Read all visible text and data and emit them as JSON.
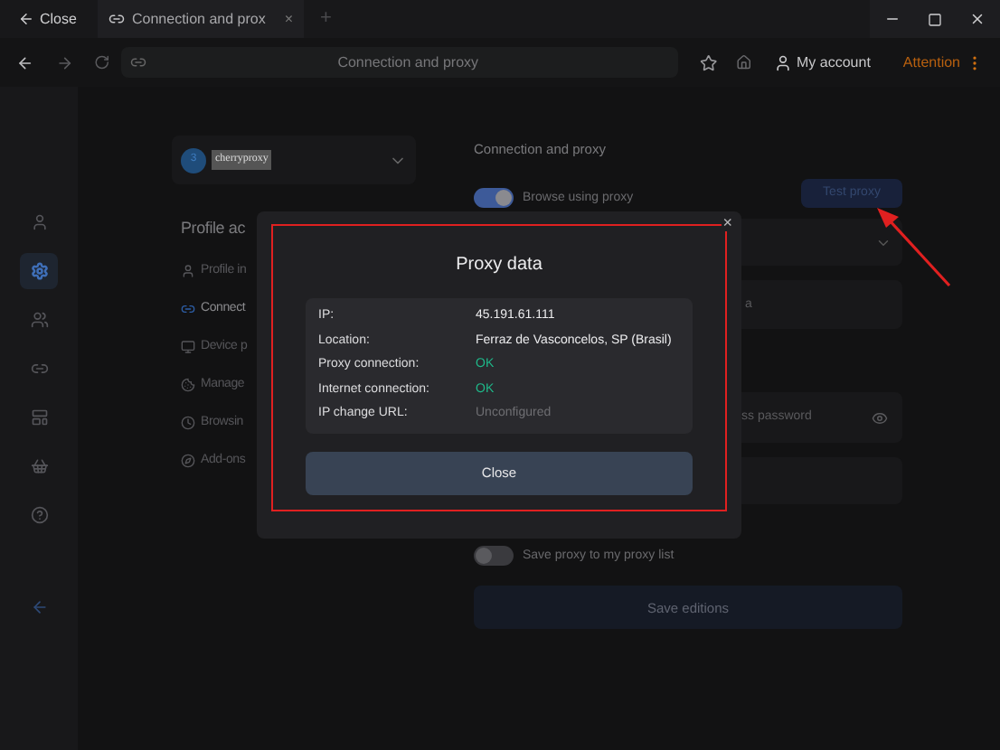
{
  "title_bar": {
    "close_label": "Close",
    "tab_title": "Connection and prox",
    "tab_close": "×",
    "new_tab": "+"
  },
  "nav_bar": {
    "address": "Connection and proxy",
    "account": "My account",
    "attention": "Attention"
  },
  "sidebar": {
    "items": [
      {
        "kind": "user",
        "selected": false
      },
      {
        "kind": "gear",
        "selected": true
      },
      {
        "kind": "users",
        "selected": false
      },
      {
        "kind": "link",
        "selected": false
      },
      {
        "kind": "layout",
        "selected": false
      },
      {
        "kind": "basket",
        "selected": false
      },
      {
        "kind": "help",
        "selected": false
      }
    ]
  },
  "profile": {
    "avatar_letter": "3",
    "name": "cherryproxy",
    "heading": "Profile ac",
    "menu": [
      {
        "label": "Profile in",
        "kind": "user",
        "selected": false
      },
      {
        "label": "Connect",
        "kind": "link",
        "selected": true
      },
      {
        "label": "Device p",
        "kind": "device",
        "selected": false
      },
      {
        "label": "Manage",
        "kind": "cookie",
        "selected": false
      },
      {
        "label": "Browsin",
        "kind": "clock",
        "selected": false
      },
      {
        "label": "Add-ons",
        "kind": "compass",
        "selected": false
      }
    ]
  },
  "connection": {
    "heading": "Connection and proxy",
    "browse_toggle": {
      "label": "Browse using proxy",
      "on": true
    },
    "test_button": "Test proxy",
    "field_2_text": "a",
    "password_placeholder": "ss password",
    "save_toggle": {
      "label": "Save proxy to my proxy list",
      "on": false
    },
    "save_button": "Save editions"
  },
  "dialog": {
    "title": "Proxy data",
    "close_icon": "×",
    "rows": [
      {
        "label": "IP:",
        "value": "45.191.61.111",
        "kind": "plain"
      },
      {
        "label": "Location:",
        "value": "Ferraz de Vasconcelos, SP (Brasil)",
        "kind": "plain"
      },
      {
        "label": "Proxy connection:",
        "value": "OK",
        "kind": "ok"
      },
      {
        "label": "Internet connection:",
        "value": "OK",
        "kind": "ok"
      },
      {
        "label": "IP change URL:",
        "value": "Unconfigured",
        "kind": "muted"
      }
    ],
    "close_button": "Close"
  }
}
